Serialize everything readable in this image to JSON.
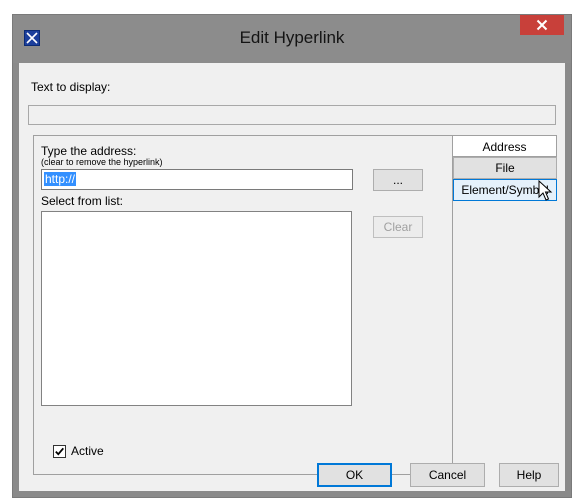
{
  "window": {
    "title": "Edit Hyperlink"
  },
  "text_to_display": {
    "label": "Text to display:",
    "value": ""
  },
  "address_panel": {
    "type_label": "Type the address:",
    "hint": "(clear to remove the hyperlink)",
    "address_value": "http://",
    "browse_label": "...",
    "select_label": "Select from list:",
    "clear_label": "Clear"
  },
  "tabs": [
    {
      "label": "Address",
      "selected": true
    },
    {
      "label": "File",
      "selected": false
    },
    {
      "label": "Element/Symbol",
      "selected": false,
      "hovered": true
    }
  ],
  "active": {
    "label": "Active",
    "checked": true
  },
  "buttons": {
    "ok": "OK",
    "cancel": "Cancel",
    "help": "Help"
  },
  "icons": {
    "app": "app-icon",
    "close": "close-icon",
    "check": "checkmark-icon",
    "cursor": "mouse-pointer-icon"
  },
  "colors": {
    "selection": "#3390ff",
    "close_button": "#c8403a",
    "tab_hover": "#e5f1fb"
  }
}
